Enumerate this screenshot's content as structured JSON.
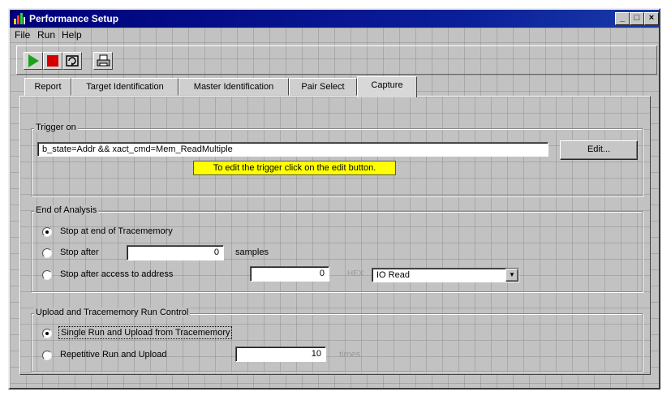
{
  "window": {
    "title": "Performance Setup",
    "controls": [
      "_",
      "□",
      "×"
    ]
  },
  "menu": [
    "File",
    "Run",
    "Help"
  ],
  "toolbar": {
    "icons": [
      "play-icon",
      "stop-icon",
      "repeat-icon",
      "print-icon"
    ],
    "colors": {
      "play": "#1aa21a",
      "stop": "#d40000"
    }
  },
  "tabs": [
    "Report",
    "Target Identification",
    "Master Identification",
    "Pair Select",
    "Capture"
  ],
  "active_tab": "Capture",
  "trigger": {
    "legend": "Trigger on",
    "expression": "b_state=Addr && xact_cmd=Mem_ReadMultiple",
    "edit_label": "Edit...",
    "hint": "To edit the trigger click on the edit button.",
    "hint_color": "#ffff00"
  },
  "end_of_analysis": {
    "legend": "End of Analysis",
    "option1": "Stop at end of Tracememory",
    "option2": "Stop after",
    "samples_value": "0",
    "samples_label": "samples",
    "option3": "Stop after access to address",
    "address_value": "0",
    "hex_label": "HEX",
    "access_type": "IO Read",
    "selected": "Stop at end of Tracememory"
  },
  "upload": {
    "legend": "Upload and Tracememory Run Control",
    "option1": "Single Run and Upload from Tracememory",
    "option2": "Repetitive Run and Upload",
    "times_value": "10",
    "times_label": "times",
    "selected": "Single Run and Upload from Tracememory"
  }
}
